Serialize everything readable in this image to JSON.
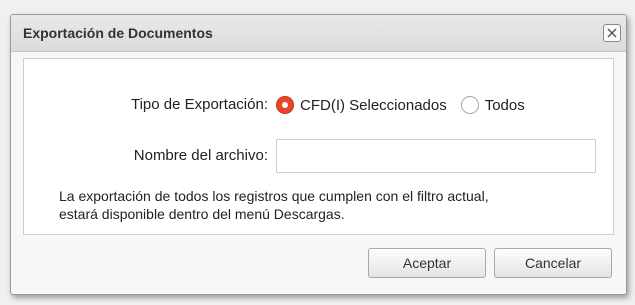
{
  "dialog": {
    "title": "Exportación de Documentos",
    "close_glyph": "×"
  },
  "form": {
    "tipo_label": "Tipo de Exportación:",
    "options": [
      {
        "label": "CFD(I) Seleccionados",
        "selected": true
      },
      {
        "label": "Todos",
        "selected": false
      }
    ],
    "nombre_label": "Nombre del archivo:",
    "nombre_value": "",
    "nombre_placeholder": ""
  },
  "note": {
    "line1": "La exportación de todos los registros que cumplen con el filtro actual,",
    "line2": "estará disponible dentro del menú Descargas."
  },
  "buttons": {
    "accept_label": "Aceptar",
    "cancel_label": "Cancelar"
  },
  "colors": {
    "radio_selected": "#e8452b",
    "title_bar": "#dcdcdc"
  }
}
